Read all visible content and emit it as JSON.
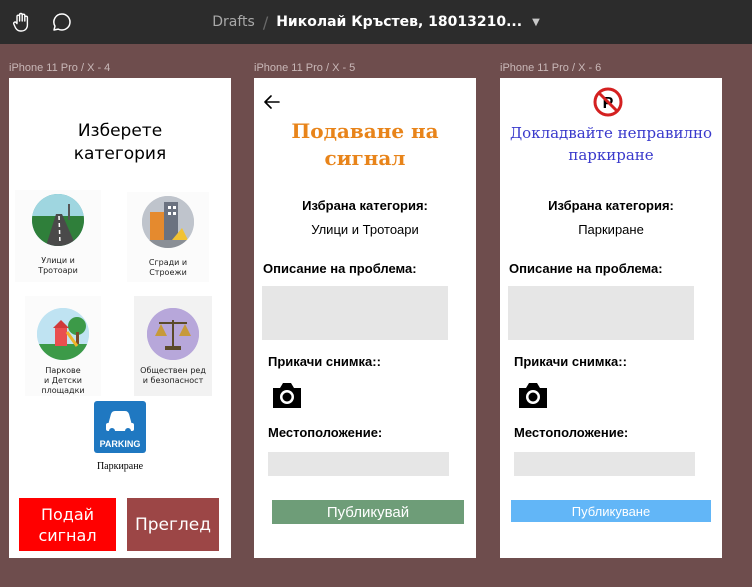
{
  "toolbar": {
    "drafts": "Drafts",
    "separator": "/",
    "file_name": "Николай Кръстев, 18013210...",
    "chevron": "⌄",
    "icons": [
      "hand-tool-icon",
      "comment-icon"
    ]
  },
  "frames": [
    {
      "label": "iPhone 11 Pro / X - 4",
      "title_line1": "Изберете",
      "title_line2": "категория",
      "categories": [
        {
          "line1": "Улици и",
          "line2": "Тротоари",
          "icon": "road-icon"
        },
        {
          "line1": "Сгради и",
          "line2": "Строежи",
          "icon": "construction-icon"
        },
        {
          "line1": "Паркове",
          "line2": "и Детски",
          "line3": "площадки",
          "icon": "playground-icon"
        },
        {
          "line1": "Обществен ред",
          "line2": "и безопасност",
          "icon": "scales-icon"
        }
      ],
      "parking_badge": "PARKING",
      "parking_label": "Паркиране",
      "submit_button_line1": "Подай",
      "submit_button_line2": "сигнал",
      "review_button": "Преглед"
    },
    {
      "label": "iPhone 11 Pro / X - 5",
      "title_line1": "Подаване на",
      "title_line2": "сигнал",
      "selected_category_label": "Избрана категория:",
      "selected_category_value": "Улици и Тротоари",
      "description_label": "Описание на проблема:",
      "attach_label": "Прикачи снимка::",
      "location_label": "Местоположение:",
      "publish_button": "Публикувай"
    },
    {
      "label": "iPhone 11 Pro / X - 6",
      "title_line1": "Докладвайте неправилно",
      "title_line2": "паркиране",
      "selected_category_label": "Избрана категория:",
      "selected_category_value": "Паркиране",
      "description_label": "Описание на проблема:",
      "attach_label": "Прикачи снимка::",
      "location_label": "Местоположение:",
      "publish_button": "Публикуване"
    }
  ],
  "colors": {
    "canvas": "#6e4d4d",
    "title_orange": "#e8841a",
    "title_blue": "#3a3acc",
    "publish_green": "#6e9d78",
    "publish_blue": "#62b6f7",
    "red_button": "#ff0000",
    "maroon_button": "#9c4646"
  }
}
